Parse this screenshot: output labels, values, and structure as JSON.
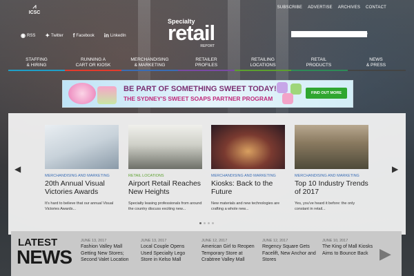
{
  "site": {
    "org_logo": "ICSC",
    "logo": {
      "line1": "Specialty",
      "line2": "retail",
      "line3": "REPORT"
    }
  },
  "toplinks": [
    "SUBSCRIBE",
    "ADVERTISE",
    "ARCHIVES",
    "CONTACT"
  ],
  "social": [
    {
      "label": "RSS",
      "icon": "rss-icon"
    },
    {
      "label": "Twitter",
      "icon": "twitter-icon"
    },
    {
      "label": "Facebook",
      "icon": "facebook-icon"
    },
    {
      "label": "LinkedIn",
      "icon": "linkedin-icon"
    }
  ],
  "search": {
    "placeholder": ""
  },
  "nav": [
    {
      "line1": "STAFFING",
      "line2": "& HIRING",
      "color": "#1fa0c8"
    },
    {
      "line1": "RUNNING A",
      "line2": "CART OR KIOSK",
      "color": "#e53b2c"
    },
    {
      "line1": "MERCHANDISING",
      "line2": "& MARKETING",
      "color": "#3a6db5"
    },
    {
      "line1": "RETAILER",
      "line2": "PROFILES",
      "color": "#7a4aa5"
    },
    {
      "line1": "RETAILING",
      "line2": "LOCATIONS",
      "color": "#5ca02f"
    },
    {
      "line1": "RETAIL",
      "line2": "PRODUCTS",
      "color": "#2e8b57"
    },
    {
      "line1": "NEWS",
      "line2": "& PRESS",
      "color": "#444444"
    }
  ],
  "banner": {
    "title": "BE PART OF SOMETHING SWEET TODAY!",
    "subtitle": "THE SYDNEY'S SWEET SOAPS PARTNER PROGRAM",
    "button": "FIND OUT MORE",
    "brand": "Sydney's"
  },
  "carousel": [
    {
      "category": "MERCHANDISING AND MARKETING",
      "title": "20th Annual Visual Victories Awards",
      "excerpt": "It's hard to believe that our annual Visual Victories Awards..."
    },
    {
      "category": "RETAIL LOCATIONS",
      "title": "Airport Retail Reaches New Heights",
      "excerpt": "Specialty leasing professionals from around the country discuss exciting new..."
    },
    {
      "category": "MERCHANDISING AND MARKETING",
      "title": "Kiosks: Back to the Future",
      "excerpt": "New materials and new technologies are crafting a whole new..."
    },
    {
      "category": "MERCHANDISING AND MARKETING",
      "title": "Top 10 Industry Trends of 2017",
      "excerpt": "Yes, you've heard it before: the only constant in retail..."
    }
  ],
  "latest_news": {
    "latest_label": "LATEST",
    "news_label": "NEWS",
    "items": [
      {
        "date": "JUNE 13, 2017",
        "headline": "Fashion Valley Mall Getting New Stores; Second Valet Location"
      },
      {
        "date": "JUNE 13, 2017",
        "headline": "Local Couple Opens Used Specialty Lego Store in Kelso Mall"
      },
      {
        "date": "JUNE 12, 2017",
        "headline": "American Girl to Reopen Temporary Store at Crabtree Valley Mall"
      },
      {
        "date": "JUNE 12, 2017",
        "headline": "Regency Square Gets Facelift, New Anchor and Stores"
      },
      {
        "date": "JUNE 10, 2017",
        "headline": "The King of Mall Kiosks Aims to Bounce Back"
      }
    ]
  }
}
